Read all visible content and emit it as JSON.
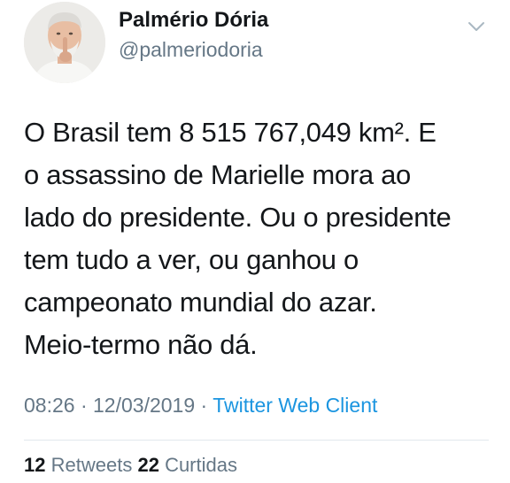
{
  "author": {
    "name": "Palmério Dória",
    "handle": "@palmeriodoria"
  },
  "tweet": {
    "lines": [
      "O Brasil tem 8 515 767,049 km². E",
      "o assassino de Marielle mora ao",
      "lado do presidente. Ou o presidente",
      "tem tudo a ver, ou ganhou o",
      "campeonato mundial do azar.",
      "Meio-termo não dá."
    ]
  },
  "meta": {
    "time": "08:26",
    "separator": "·",
    "date": "12/03/2019",
    "source": "Twitter Web Client"
  },
  "stats": {
    "retweets_count": "12",
    "retweets_label": "Retweets",
    "likes_count": "22",
    "likes_label": "Curtidas"
  },
  "icons": {
    "menu": "chevron-down-icon",
    "avatar": "avatar"
  },
  "colors": {
    "link": "#1b95e0",
    "muted": "#657786",
    "text": "#14171a",
    "divider": "#e1e8ed"
  }
}
